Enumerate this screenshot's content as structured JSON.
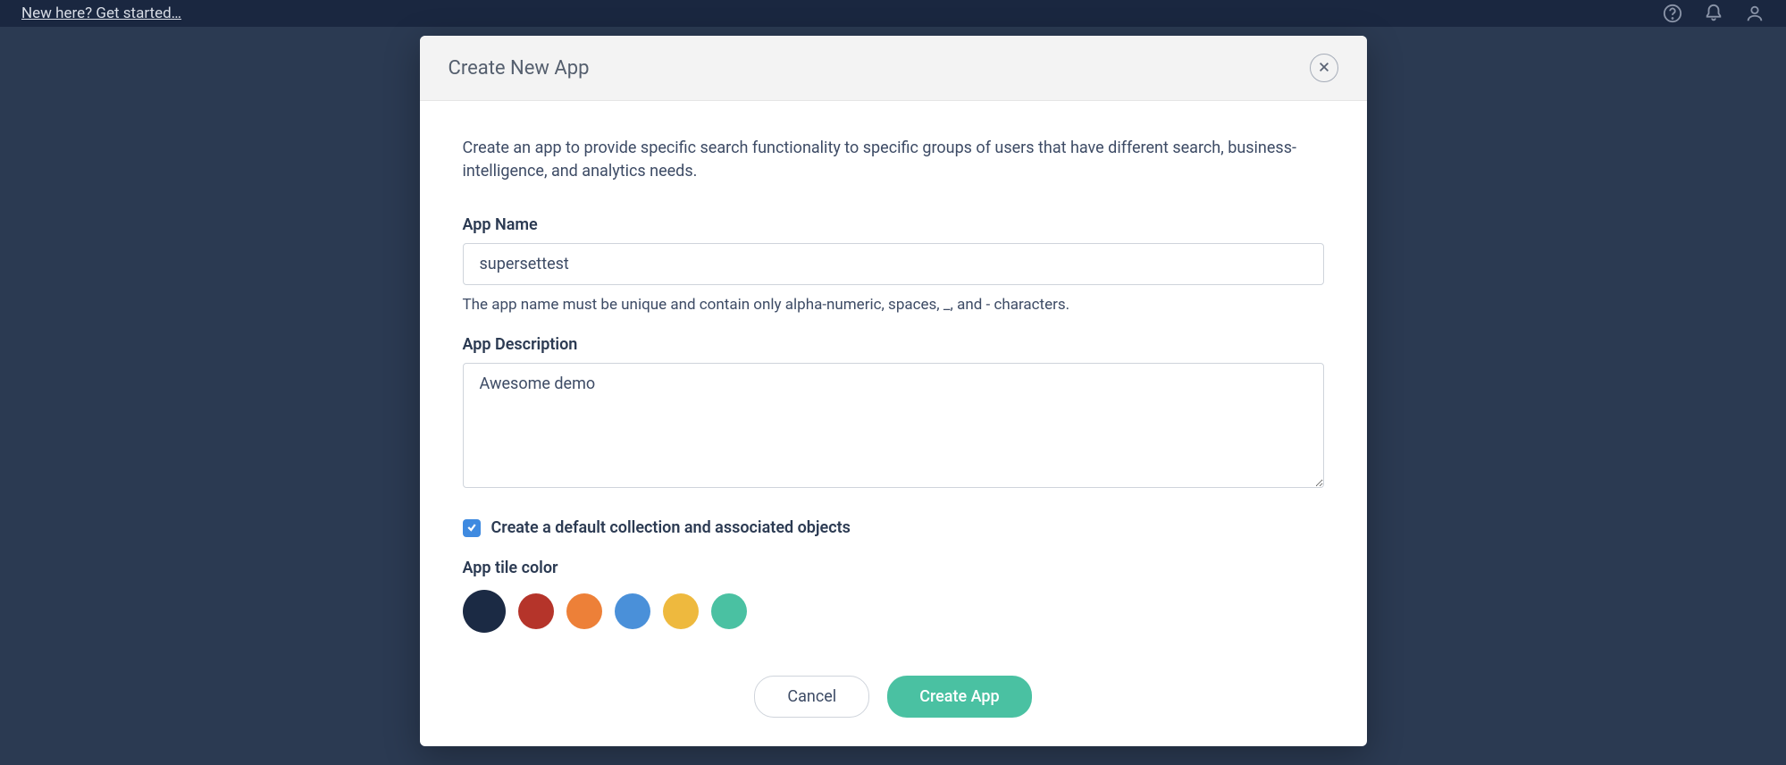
{
  "topbar": {
    "link_text": "New here? Get started…"
  },
  "modal": {
    "title": "Create New App",
    "intro": "Create an app to provide specific search functionality to specific groups of users that have different search, business-intelligence, and analytics needs.",
    "app_name_label": "App Name",
    "app_name_value": "supersettest",
    "app_name_help": "The app name must be unique and contain only alpha-numeric, spaces, _, and - characters.",
    "app_description_label": "App Description",
    "app_description_value": "Awesome demo",
    "checkbox_label": "Create a default collection and associated objects",
    "checkbox_checked": true,
    "tile_color_label": "App tile color",
    "colors": {
      "navy": "#1b2a44",
      "red": "#b5342a",
      "orange": "#ed8038",
      "blue": "#4a90d9",
      "yellow": "#eeb93e",
      "teal": "#4ac1a2"
    },
    "selected_color": "navy",
    "cancel_label": "Cancel",
    "create_label": "Create App"
  }
}
